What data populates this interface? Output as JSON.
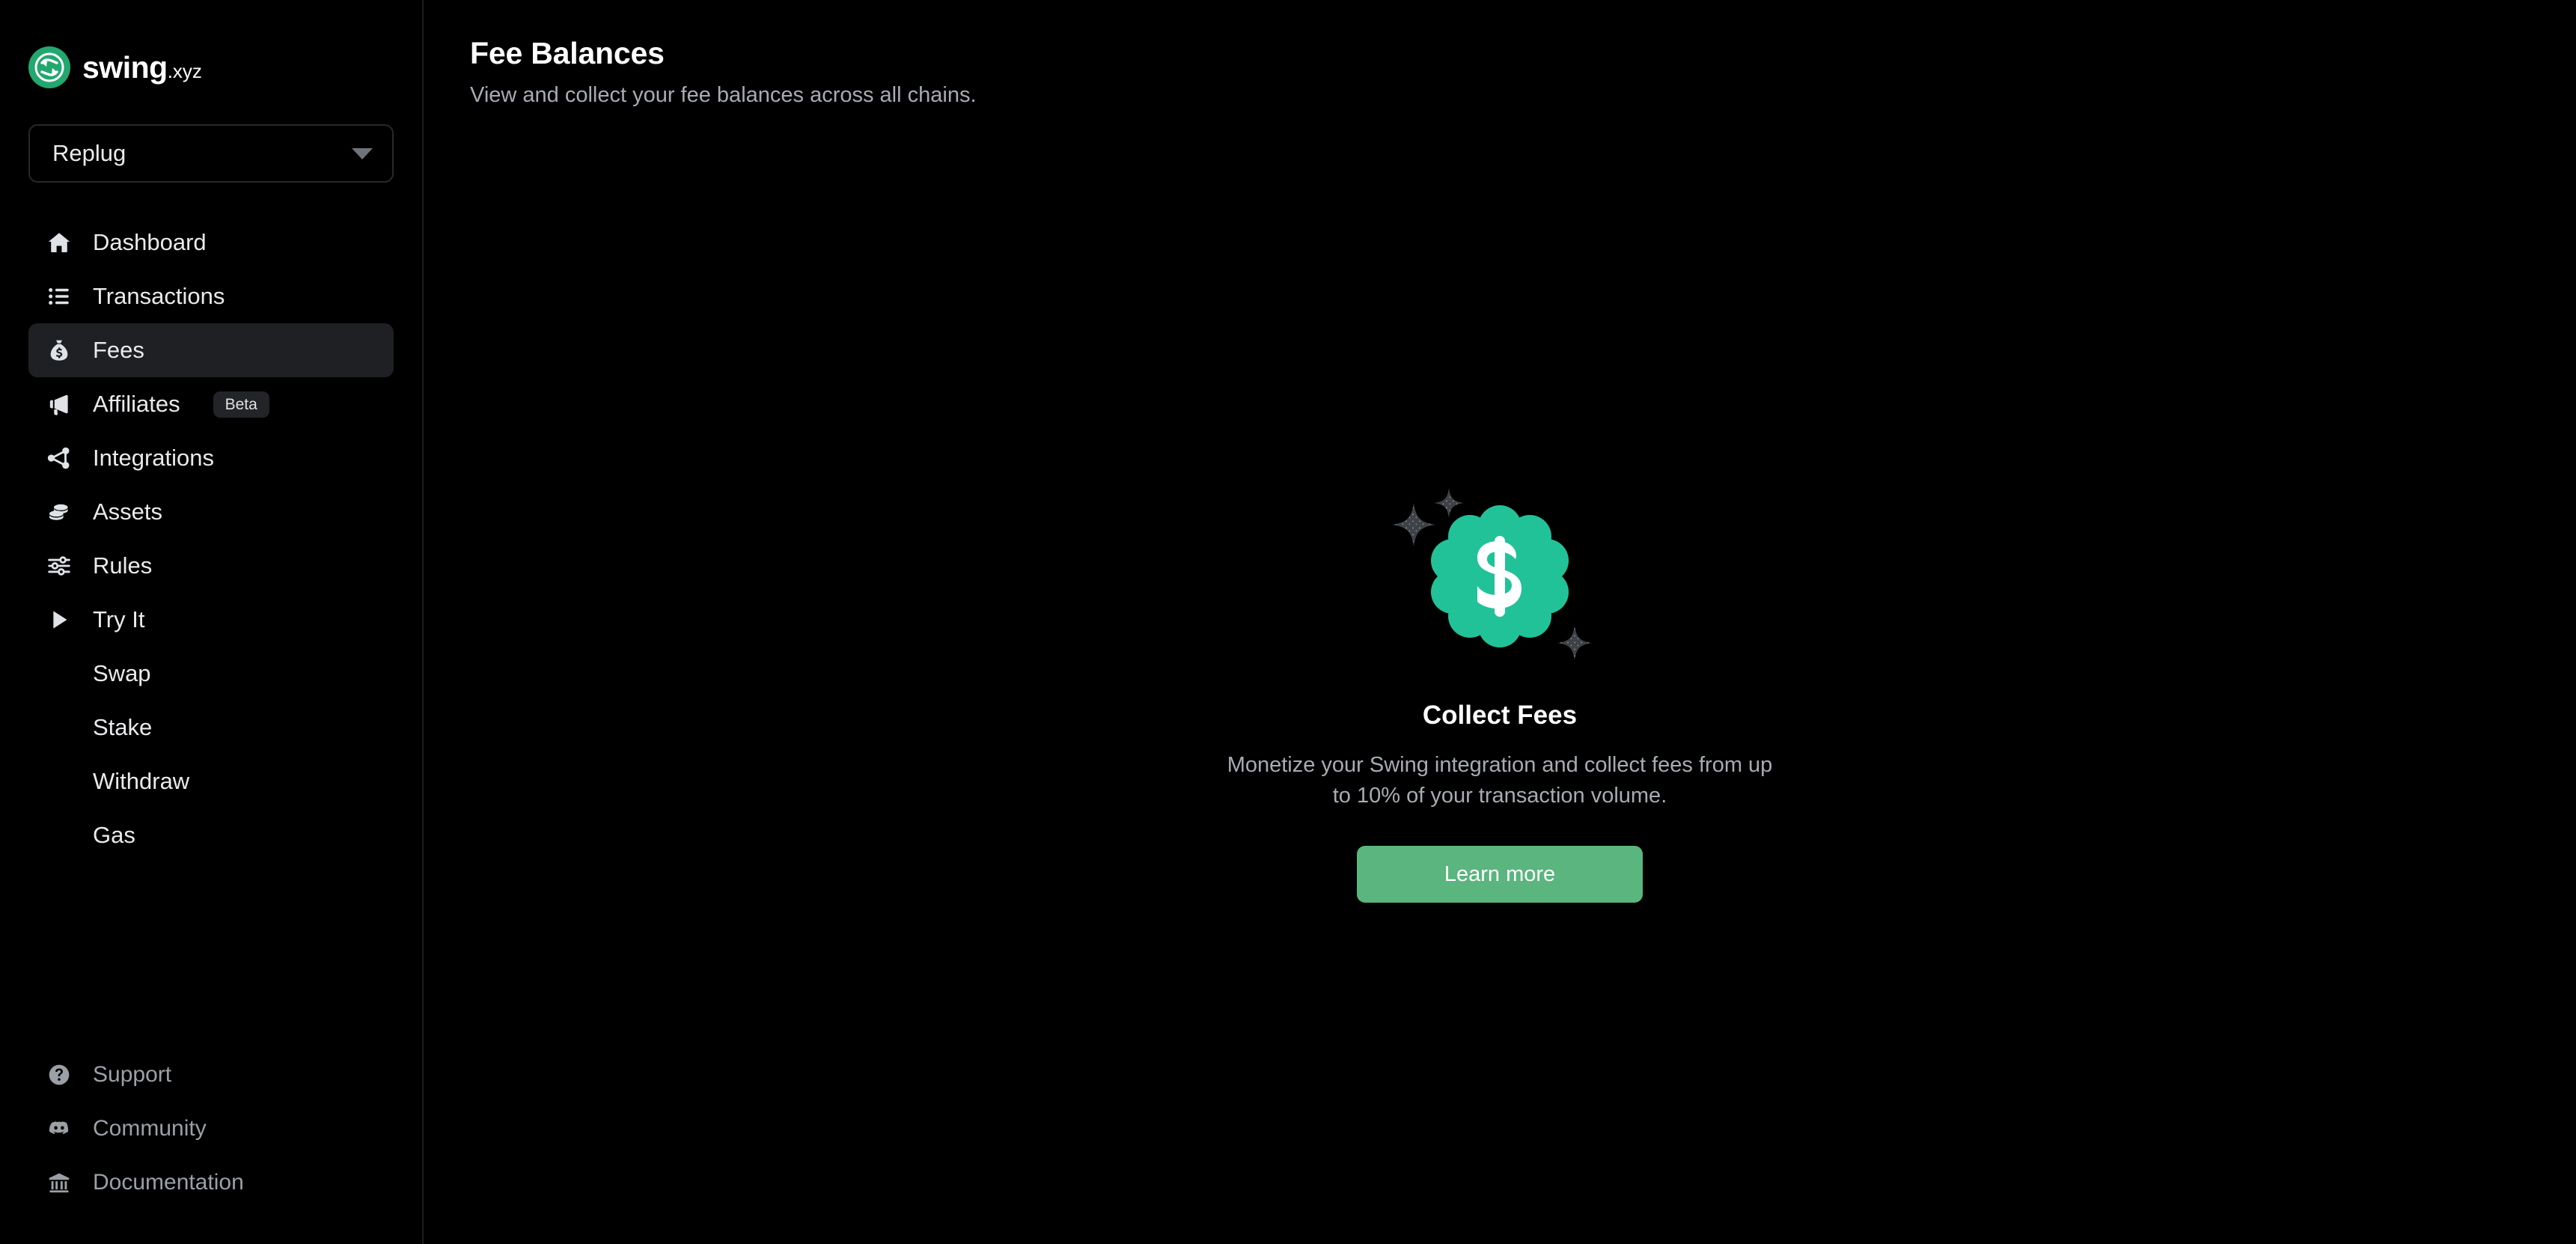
{
  "brand": {
    "name": "swing",
    "tld": ".xyz",
    "logo_color": "#22a86f"
  },
  "project_selector": {
    "value": "Replug",
    "icon": "chevron-down-icon"
  },
  "sidebar": {
    "items": [
      {
        "label": "Dashboard",
        "icon": "home-icon",
        "active": false
      },
      {
        "label": "Transactions",
        "icon": "list-icon",
        "active": false
      },
      {
        "label": "Fees",
        "icon": "money-bag-icon",
        "active": true
      },
      {
        "label": "Affiliates",
        "icon": "megaphone-icon",
        "active": false,
        "badge": "Beta"
      },
      {
        "label": "Integrations",
        "icon": "share-nodes-icon",
        "active": false
      },
      {
        "label": "Assets",
        "icon": "coins-stack-icon",
        "active": false
      },
      {
        "label": "Rules",
        "icon": "sliders-icon",
        "active": false
      },
      {
        "label": "Try It",
        "icon": "play-icon",
        "active": false
      }
    ],
    "sub_items": [
      {
        "label": "Swap"
      },
      {
        "label": "Stake"
      },
      {
        "label": "Withdraw"
      },
      {
        "label": "Gas"
      }
    ],
    "footer_items": [
      {
        "label": "Support",
        "icon": "question-circle-icon"
      },
      {
        "label": "Community",
        "icon": "discord-icon"
      },
      {
        "label": "Documentation",
        "icon": "bank-icon"
      }
    ]
  },
  "header": {
    "title": "Fee Balances",
    "subtitle": "View and collect your fee balances across all chains."
  },
  "empty_state": {
    "illustration": "dollar-badge-sparkles-icon",
    "title": "Collect Fees",
    "description": "Monetize your Swing integration and collect fees from up to 10% of your transaction volume.",
    "button_label": "Learn more",
    "badge_color": "#22c298",
    "button_color": "#5ab57f",
    "sparkle_color": "#3e4247"
  }
}
